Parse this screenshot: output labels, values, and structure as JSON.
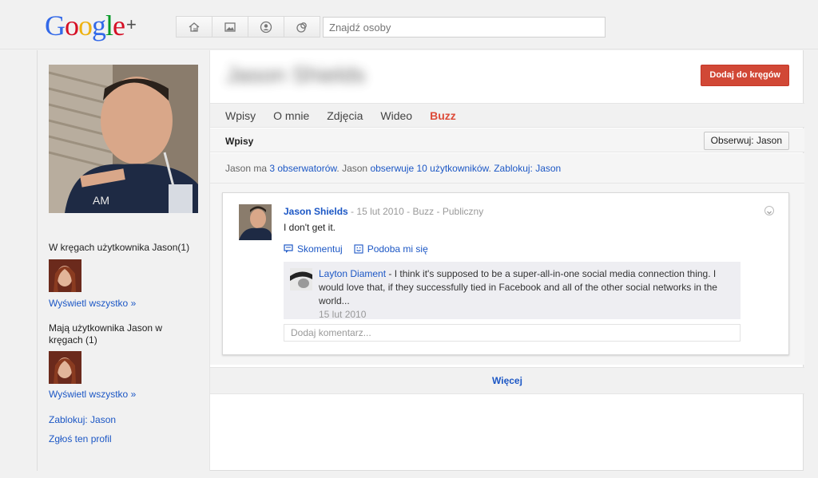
{
  "header": {
    "logo_text": "Google",
    "logo_plus": "+",
    "logo_colors": [
      "#3369e8",
      "#d50f25",
      "#eeb211",
      "#3369e8",
      "#009925",
      "#d50f25"
    ],
    "nav_icons": [
      "home-icon",
      "photos-icon",
      "profile-icon",
      "circles-icon"
    ],
    "search_placeholder": "Znajdź osoby"
  },
  "sidebar": {
    "in_circles_label": "W kręgach użytkownika Jason(1)",
    "show_all_1": "Wyświetl wszystko »",
    "have_in_circles_label": "Mają użytkownika Jason w kręgach (1)",
    "show_all_2": "Wyświetl wszystko »",
    "block_link": "Zablokuj: Jason",
    "report_link": "Zgłoś ten profil"
  },
  "profile": {
    "name": "Jason Shields",
    "add_button": "Dodaj do kręgów",
    "follow_button": "Obserwuj: Jason"
  },
  "tabs": [
    {
      "label": "Wpisy"
    },
    {
      "label": "O mnie"
    },
    {
      "label": "Zdjęcia"
    },
    {
      "label": "Wideo"
    },
    {
      "label": "Buzz"
    }
  ],
  "active_tab_color": "#dd4b39",
  "section_title": "Wpisy",
  "stats": {
    "part1": "Jason ma ",
    "followers_link": "3 obserwatorów",
    "part2": ". Jason ",
    "following_link": "obserwuje 10 użytkowników",
    "part3": ". ",
    "block_link": "Zablokuj: Jason"
  },
  "post": {
    "author": "Jason Shields",
    "date": "15 lut 2010",
    "source": "Buzz",
    "visibility": "Publiczny",
    "separator": "-",
    "text": "I don't get it.",
    "comment_action": "Skomentuj",
    "like_action": "Podoba mi się",
    "comment": {
      "author": "Layton Diament",
      "text": " - I think it's supposed to be a super-all-in-one social media connection thing. I would love that, if they successfully tied in Facebook and all of the other social networks in the world...",
      "date": "15 lut 2010"
    },
    "add_comment_placeholder": "Dodaj komentarz..."
  },
  "more_button": "Więcej",
  "link_color": "#1c57c5",
  "button_red": "#d14836"
}
